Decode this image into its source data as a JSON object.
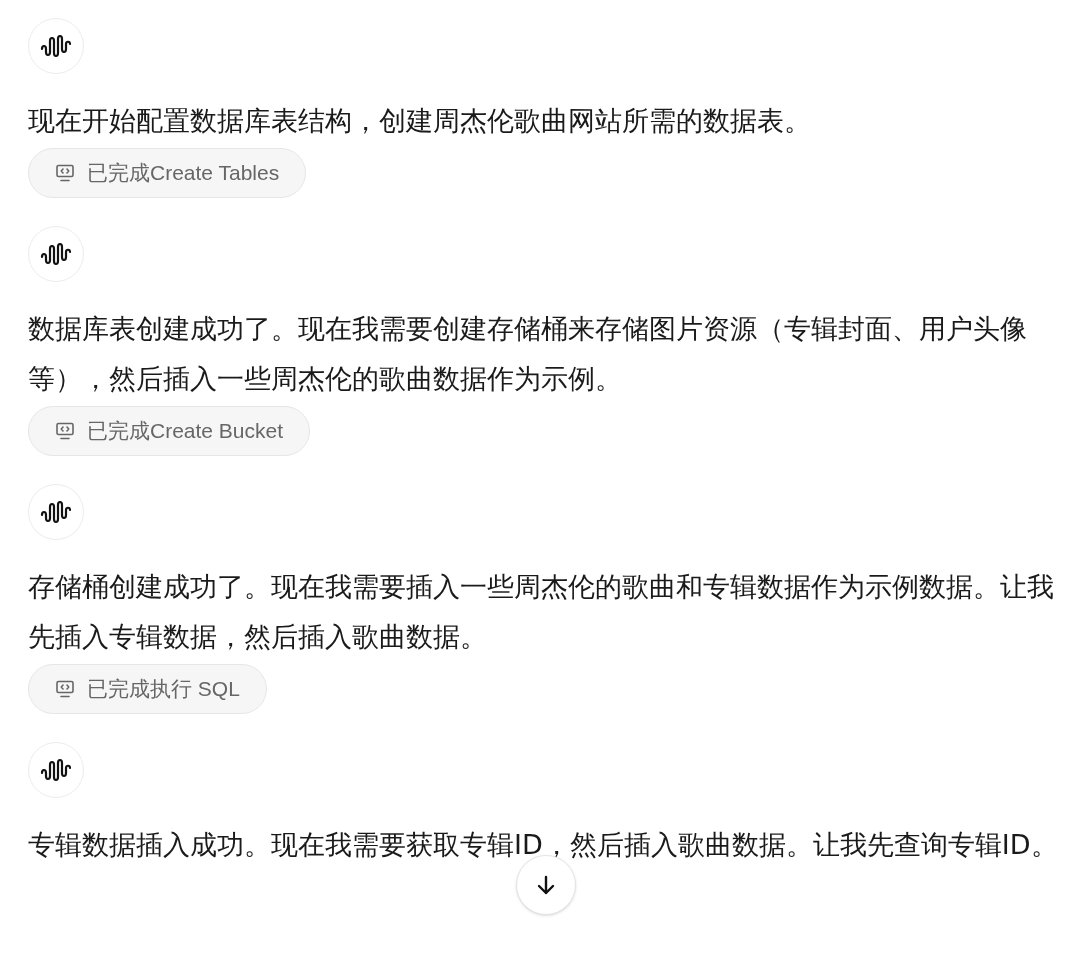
{
  "messages": [
    {
      "kind": "avatar"
    },
    {
      "kind": "text",
      "text": "现在开始配置数据库表结构，创建周杰伦歌曲网站所需的数据表。"
    },
    {
      "kind": "tool",
      "label": "已完成Create Tables"
    },
    {
      "kind": "avatar"
    },
    {
      "kind": "text",
      "text": "数据库表创建成功了。现在我需要创建存储桶来存储图片资源（专辑封面、用户头像等），然后插入一些周杰伦的歌曲数据作为示例。"
    },
    {
      "kind": "tool",
      "label": "已完成Create Bucket"
    },
    {
      "kind": "avatar"
    },
    {
      "kind": "text",
      "text": "存储桶创建成功了。现在我需要插入一些周杰伦的歌曲和专辑数据作为示例数据。让我先插入专辑数据，然后插入歌曲数据。"
    },
    {
      "kind": "tool",
      "label": "已完成执行 SQL"
    },
    {
      "kind": "avatar"
    },
    {
      "kind": "text",
      "text": "专辑数据插入成功。现在我需要获取专辑ID，然后插入歌曲数据。让我先查询专辑ID。"
    }
  ]
}
